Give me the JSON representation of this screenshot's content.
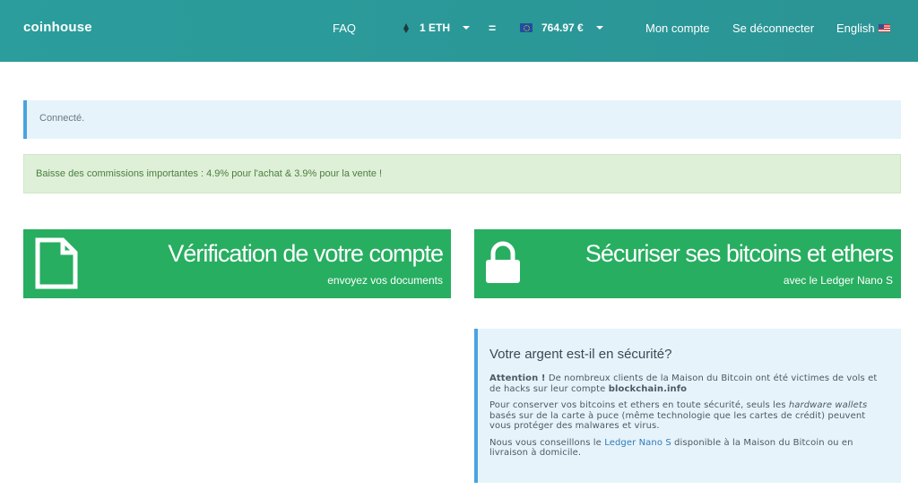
{
  "header": {
    "brand": "coinhouse",
    "faq": "FAQ",
    "crypto_amount": "1 ETH",
    "equals": "=",
    "fiat_amount": "764.97 €",
    "account": "Mon compte",
    "logout": "Se déconnecter",
    "language": "English",
    "bar_color": "#2b9d9c"
  },
  "alerts": {
    "info": "Connecté.",
    "success": "Baisse des commissions importantes : 4.9% pour l'achat & 3.9% pour la vente !"
  },
  "cards": {
    "verification": {
      "title": "Vérification de votre compte",
      "subtitle": "envoyez vos documents",
      "icon": "document-icon"
    },
    "secure": {
      "title": "Sécuriser ses bitcoins et ethers",
      "subtitle": "avec le Ledger Nano S",
      "icon": "lock-icon"
    },
    "color": "#27ae60"
  },
  "security_panel": {
    "title": "Votre argent est-il en sécurité?",
    "p1_strong": "Attention !",
    "p1_text": " De nombreux clients de la Maison du Bitcoin ont été victimes de vols et de hacks sur leur compte ",
    "p1_strong2": "blockchain.info",
    "p2_text": "Pour conserver vos bitcoins et ethers en toute sécurité, seuls les ",
    "p2_em": "hardware wallets",
    "p2_text2": " basés sur de la carte à puce (même technologie que les cartes de crédit) peuvent vous protéger des malwares et virus.",
    "p3_text": "Nous vous conseillons le ",
    "p3_link": "Ledger Nano S",
    "p3_text2": " disponible à la Maison du Bitcoin ou en livraison à domicile."
  }
}
